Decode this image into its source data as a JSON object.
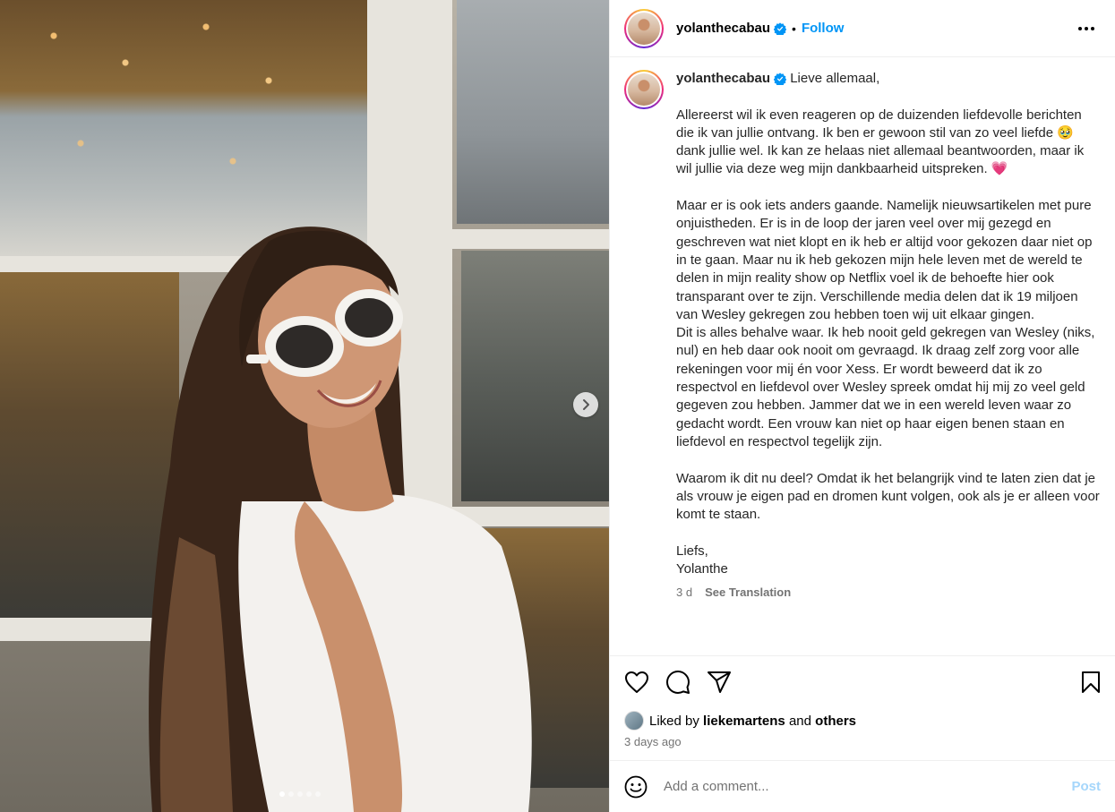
{
  "post": {
    "username": "yolanthecabau",
    "follow_label": "Follow",
    "bullet": "•",
    "verified": true
  },
  "media": {
    "slide_count": 5,
    "active_slide": 1
  },
  "caption": {
    "username": "yolanthecabau",
    "text": "Lieve allemaal,\n\nAllereerst wil ik even reageren op de duizenden liefdevolle berichten die ik van jullie ontvang. Ik ben er gewoon stil van zo veel liefde 🥹 dank jullie wel. Ik kan ze helaas niet allemaal beantwoorden, maar ik wil jullie via deze weg mijn dankbaarheid uitspreken. 💗\n\nMaar er is ook iets anders gaande. Namelijk nieuwsartikelen met pure onjuistheden. Er is in de loop der jaren veel over mij gezegd en geschreven wat niet klopt en ik heb er altijd voor gekozen daar niet op in te gaan. Maar nu ik heb gekozen mijn hele leven met de wereld te delen in mijn reality show op Netflix voel ik de behoefte hier ook transparant over te zijn. Verschillende media delen dat ik 19 miljoen van Wesley gekregen zou hebben toen wij uit elkaar gingen.\nDit is alles behalve waar. Ik heb nooit geld gekregen van Wesley (niks, nul) en heb daar ook nooit om gevraagd. Ik draag zelf zorg voor alle rekeningen voor mij én voor Xess. Er wordt beweerd dat ik zo respectvol en liefdevol over Wesley spreek omdat hij mij zo veel geld gegeven zou hebben. Jammer dat we in een wereld leven waar zo gedacht wordt. Een vrouw kan niet op haar eigen benen staan en liefdevol en respectvol tegelijk zijn.\n\nWaarom ik dit nu deel? Omdat ik het belangrijk vind te laten zien dat je als vrouw je eigen pad en dromen kunt volgen, ook als je er alleen voor komt te staan.\n\nLiefs,\nYolanthe",
    "age": "3 d",
    "see_translation": "See Translation"
  },
  "likes": {
    "prefix": "Liked by",
    "liker": "liekemartens",
    "and": "and",
    "others": "others"
  },
  "timestamp": "3 days ago",
  "comment_box": {
    "placeholder": "Add a comment...",
    "post_label": "Post"
  },
  "icons": {
    "verified": "verified-badge-icon",
    "more": "more-options-icon",
    "like": "heart-icon",
    "comment": "comment-icon",
    "share": "share-icon",
    "save": "bookmark-icon",
    "emoji": "emoji-icon",
    "next": "chevron-right-icon"
  },
  "colors": {
    "accent": "#0095f6",
    "verified": "#0095f6",
    "post_disabled": "#a5d6fb",
    "secondary_text": "#737373"
  }
}
